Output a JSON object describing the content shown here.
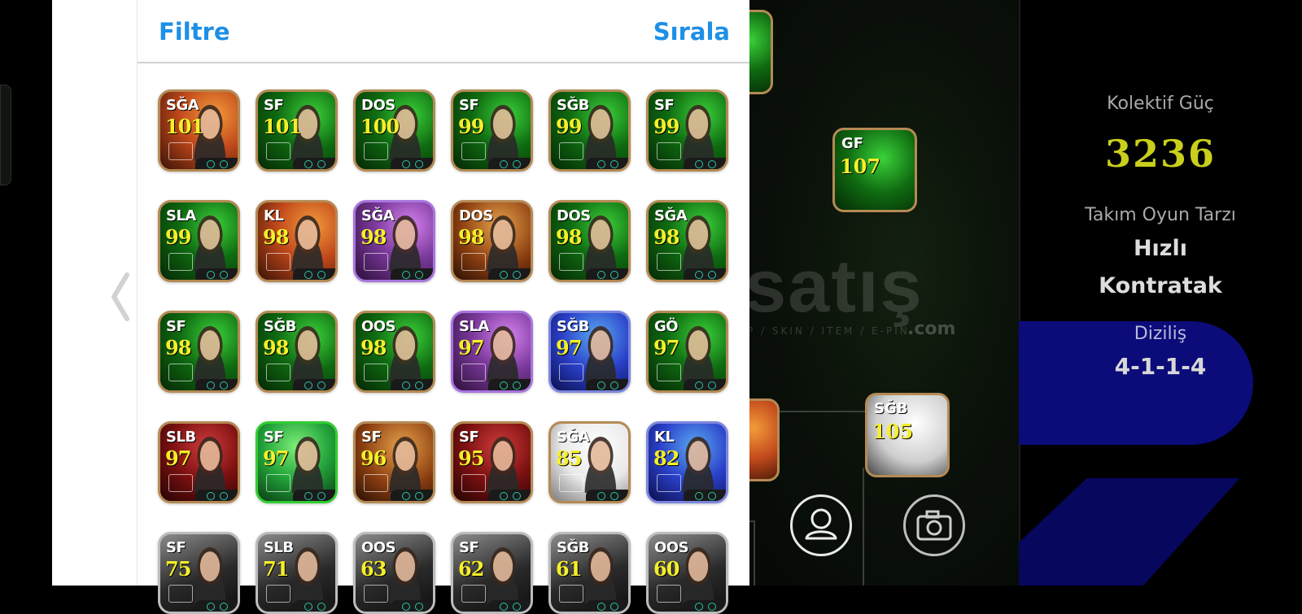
{
  "filter_panel": {
    "filter_label": "Filtre",
    "sort_label": "Sırala"
  },
  "cards": [
    {
      "pos": "SĞA",
      "ovr": "101",
      "bg": "orange"
    },
    {
      "pos": "SF",
      "ovr": "101",
      "bg": "green"
    },
    {
      "pos": "DOS",
      "ovr": "100",
      "bg": "green"
    },
    {
      "pos": "SF",
      "ovr": "99",
      "bg": "green"
    },
    {
      "pos": "SĞB",
      "ovr": "99",
      "bg": "green"
    },
    {
      "pos": "SF",
      "ovr": "99",
      "bg": "green"
    },
    {
      "pos": "SLA",
      "ovr": "99",
      "bg": "green"
    },
    {
      "pos": "KL",
      "ovr": "98",
      "bg": "orange"
    },
    {
      "pos": "SĞA",
      "ovr": "98",
      "bg": "purple"
    },
    {
      "pos": "DOS",
      "ovr": "98",
      "bg": "gold"
    },
    {
      "pos": "DOS",
      "ovr": "98",
      "bg": "green"
    },
    {
      "pos": "SĞA",
      "ovr": "98",
      "bg": "green"
    },
    {
      "pos": "SF",
      "ovr": "98",
      "bg": "green"
    },
    {
      "pos": "SĞB",
      "ovr": "98",
      "bg": "green"
    },
    {
      "pos": "OOS",
      "ovr": "98",
      "bg": "green"
    },
    {
      "pos": "SLA",
      "ovr": "97",
      "bg": "purple"
    },
    {
      "pos": "SĞB",
      "ovr": "97",
      "bg": "blue"
    },
    {
      "pos": "GÖ",
      "ovr": "97",
      "bg": "green"
    },
    {
      "pos": "SLB",
      "ovr": "97",
      "bg": "red"
    },
    {
      "pos": "SF",
      "ovr": "97",
      "bg": "lime"
    },
    {
      "pos": "SF",
      "ovr": "96",
      "bg": "gold"
    },
    {
      "pos": "SF",
      "ovr": "95",
      "bg": "red"
    },
    {
      "pos": "SĞA",
      "ovr": "85",
      "bg": "white"
    },
    {
      "pos": "KL",
      "ovr": "82",
      "bg": "blue"
    },
    {
      "pos": "SF",
      "ovr": "75",
      "bg": "dark"
    },
    {
      "pos": "SLB",
      "ovr": "71",
      "bg": "dark"
    },
    {
      "pos": "OOS",
      "ovr": "63",
      "bg": "dark"
    },
    {
      "pos": "SF",
      "ovr": "62",
      "bg": "dark"
    },
    {
      "pos": "SĞB",
      "ovr": "61",
      "bg": "dark"
    },
    {
      "pos": "OOS",
      "ovr": "60",
      "bg": "dark"
    }
  ],
  "pitch": {
    "players": [
      {
        "pos": "GF",
        "ovr": "107"
      },
      {
        "pos": "SĞB",
        "ovr": "105"
      }
    ],
    "watermark": "satış",
    "watermark_sub": "P / SKIN / ITEM / E-PIN",
    "watermark_com": ".com"
  },
  "team_info": {
    "power_label": "Kolektif Güç",
    "power_value": "3236",
    "style_label": "Takım Oyun Tarzı",
    "style_value_1": "Hızlı",
    "style_value_2": "Kontratak",
    "formation_label": "Diziliş",
    "formation_value": "4-1-1-4"
  },
  "colors": {
    "accent_blue": "#1e8fe6",
    "power_yellow": "#c9cf1b",
    "card_border": "#b48a54"
  },
  "icons": {
    "back": "chevron-left-icon",
    "profile": "person-icon",
    "camera": "camera-icon"
  }
}
